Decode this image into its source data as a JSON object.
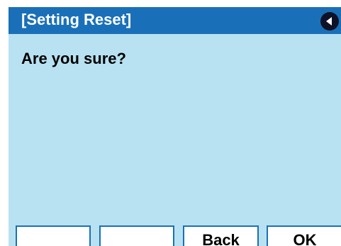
{
  "title_bar": {
    "title": "[Setting Reset]",
    "nav_icon": "triangle-left-icon"
  },
  "message": "Are you sure?",
  "softkeys": [
    {
      "label": ""
    },
    {
      "label": ""
    },
    {
      "label": "Back"
    },
    {
      "label": "OK"
    }
  ],
  "colors": {
    "title_bar": "#1a70b8",
    "background": "#b8e2f2",
    "softkey_border": "#1a70b8",
    "softkey_fill": "#ffffff",
    "nav_button": "#0d1226"
  }
}
